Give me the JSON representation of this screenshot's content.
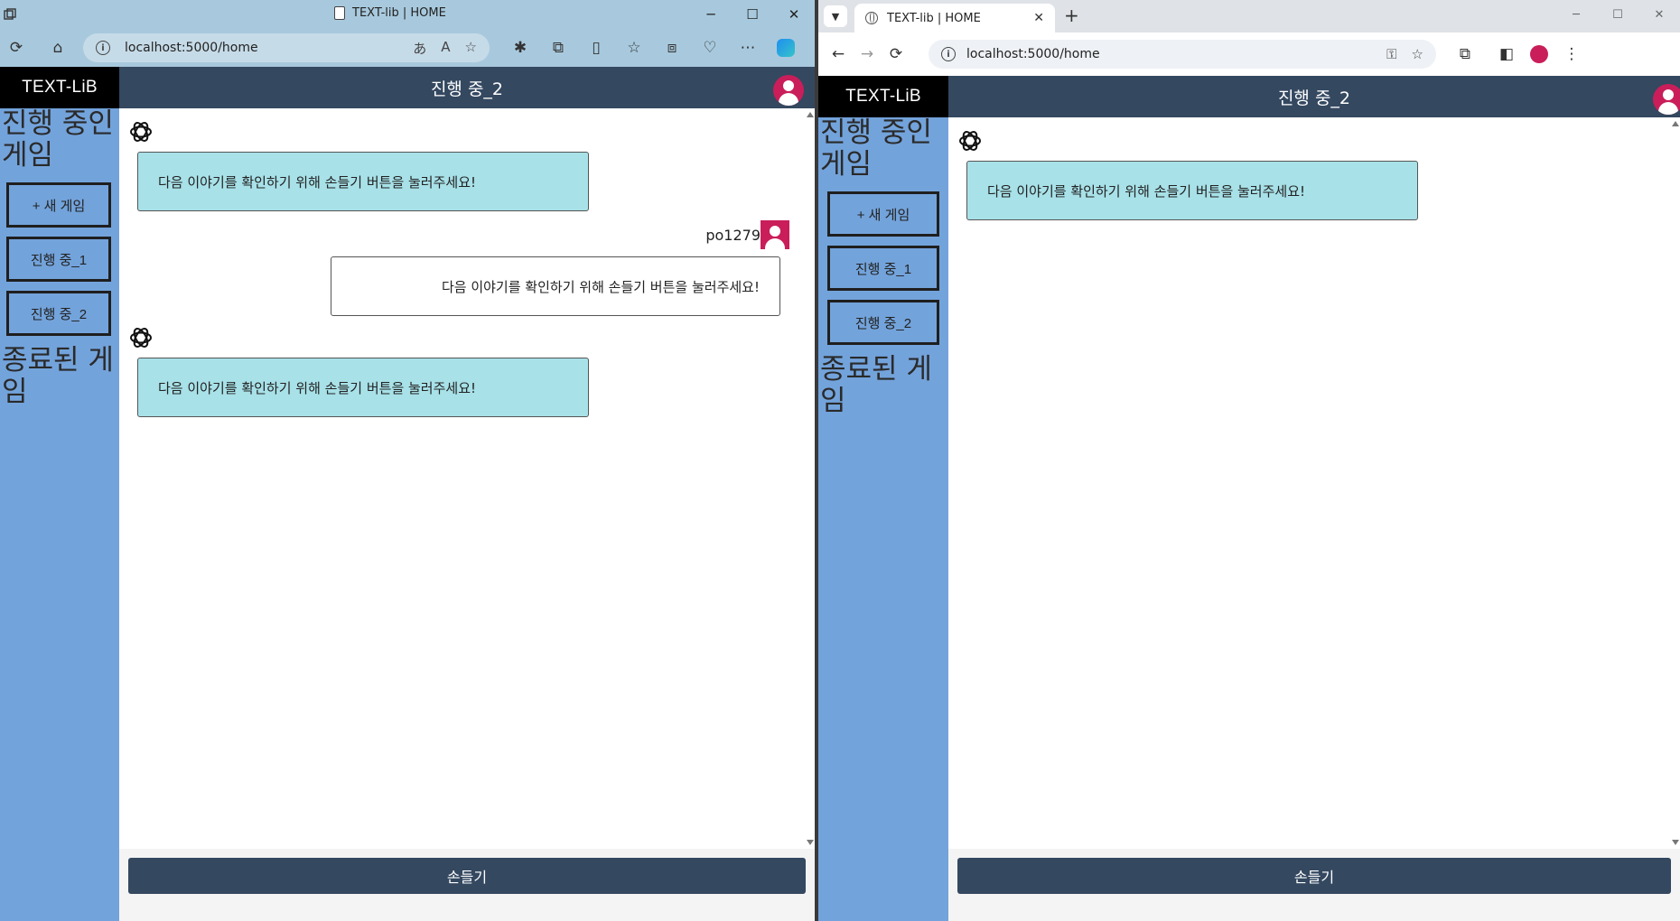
{
  "left_window": {
    "browser": {
      "tab_title": "TEXT-lib | HOME",
      "url": "localhost:5000/home",
      "controls": {
        "minimize": "─",
        "maximize": "☐",
        "close": "✕"
      }
    },
    "app": {
      "brand": "TEXT-LiB",
      "header_title": "진행 중_2",
      "sidebar": {
        "ongoing_title": "진행 중인 게임",
        "new_game": "+ 새 게임",
        "games": [
          "진행 중_1",
          "진행 중_2"
        ],
        "finished_title": "종료된 게임"
      },
      "messages": [
        {
          "role": "ai",
          "text": "다음 이야기를 확인하기 위해 손들기 버튼을 눌러주세요!"
        },
        {
          "role": "user",
          "username": "po1279",
          "text": "다음 이야기를 확인하기 위해 손들기 버튼을 눌러주세요!"
        },
        {
          "role": "ai",
          "text": "다음 이야기를 확인하기 위해 손들기 버튼을 눌러주세요!"
        }
      ],
      "raise_hand_button": "손들기"
    }
  },
  "right_window": {
    "browser": {
      "tab_title": "TEXT-lib | HOME",
      "url": "localhost:5000/home",
      "controls": {
        "minimize": "─",
        "maximize": "☐",
        "close": "✕"
      }
    },
    "app": {
      "brand": "TEXT-LiB",
      "header_title": "진행 중_2",
      "sidebar": {
        "ongoing_title": "진행 중인 게임",
        "new_game": "+ 새 게임",
        "games": [
          "진행 중_1",
          "진행 중_2"
        ],
        "finished_title": "종료된 게임"
      },
      "messages": [
        {
          "role": "ai",
          "text": "다음 이야기를 확인하기 위해 손들기 버튼을 눌러주세요!"
        }
      ],
      "raise_hand_button": "손들기"
    }
  },
  "colors": {
    "sidebar": "#73a3db",
    "header": "#344860",
    "brand_bg": "#000000",
    "ai_bubble": "#a8e1e8",
    "avatar": "#c91e5a"
  },
  "icons": [
    "openai-logo-icon",
    "user-avatar-icon",
    "refresh-icon",
    "home-icon",
    "star-icon",
    "back-icon",
    "forward-icon",
    "key-icon",
    "extensions-icon",
    "more-icon"
  ]
}
